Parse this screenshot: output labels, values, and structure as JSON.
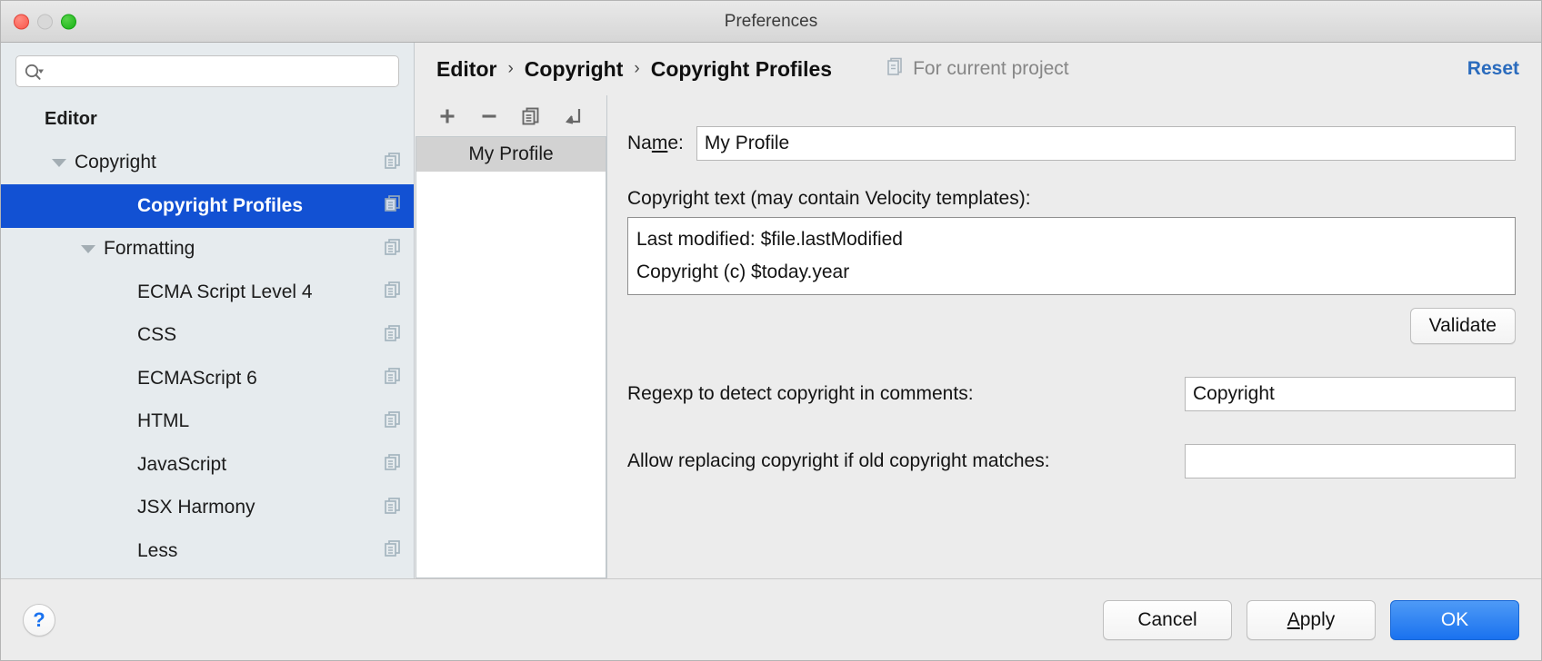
{
  "window": {
    "title": "Preferences",
    "traffic_lights": [
      "close",
      "minimize",
      "zoom"
    ]
  },
  "sidebar": {
    "search": {
      "value": "",
      "placeholder": "",
      "icon": "search-icon"
    },
    "items": [
      {
        "label": "Editor",
        "level": 0,
        "expandable": false,
        "expanded": false,
        "selected": false,
        "copy_badge": false
      },
      {
        "label": "Copyright",
        "level": 1,
        "expandable": true,
        "expanded": true,
        "selected": false,
        "copy_badge": true
      },
      {
        "label": "Copyright Profiles",
        "level": 3,
        "expandable": false,
        "expanded": false,
        "selected": true,
        "copy_badge": true
      },
      {
        "label": "Formatting",
        "level": 2,
        "expandable": true,
        "expanded": true,
        "selected": false,
        "copy_badge": true
      },
      {
        "label": "ECMA Script Level 4",
        "level": 3,
        "expandable": false,
        "expanded": false,
        "selected": false,
        "copy_badge": true
      },
      {
        "label": "CSS",
        "level": 3,
        "expandable": false,
        "expanded": false,
        "selected": false,
        "copy_badge": true
      },
      {
        "label": "ECMAScript 6",
        "level": 3,
        "expandable": false,
        "expanded": false,
        "selected": false,
        "copy_badge": true
      },
      {
        "label": "HTML",
        "level": 3,
        "expandable": false,
        "expanded": false,
        "selected": false,
        "copy_badge": true
      },
      {
        "label": "JavaScript",
        "level": 3,
        "expandable": false,
        "expanded": false,
        "selected": false,
        "copy_badge": true
      },
      {
        "label": "JSX Harmony",
        "level": 3,
        "expandable": false,
        "expanded": false,
        "selected": false,
        "copy_badge": true
      },
      {
        "label": "Less",
        "level": 3,
        "expandable": false,
        "expanded": false,
        "selected": false,
        "copy_badge": true
      }
    ],
    "selection_color": "#1251d3",
    "background_color": "#e6ebee"
  },
  "header": {
    "breadcrumb": [
      "Editor",
      "Copyright",
      "Copyright Profiles"
    ],
    "separator": "›",
    "scope_label": "For current project",
    "scope_icon": "project-scope-icon",
    "reset_label": "Reset",
    "reset_color": "#2a6bbd"
  },
  "profiles": {
    "toolbar": [
      {
        "name": "add-profile-button",
        "icon": "plus-icon"
      },
      {
        "name": "remove-profile-button",
        "icon": "minus-icon"
      },
      {
        "name": "copy-profile-button",
        "icon": "copy-icon"
      },
      {
        "name": "import-profile-button",
        "icon": "arrow-down-left-icon"
      }
    ],
    "items": [
      {
        "label": "My Profile",
        "selected": true
      }
    ]
  },
  "form": {
    "name_label_pre": "Na",
    "name_label_mnemonic": "m",
    "name_label_post": "e:",
    "name_value": "My Profile",
    "name_placeholder": "",
    "copyright_text_label": "Copyright text (may contain Velocity templates):",
    "copyright_text_value": "Last modified: $file.lastModified\nCopyright (c) $today.year",
    "validate_label": "Validate",
    "regexp_label": "Regexp to detect copyright in comments:",
    "regexp_value": "Copyright",
    "regexp_placeholder": "",
    "allow_replace_label": "Allow replacing copyright if old copyright matches:",
    "allow_replace_value": "",
    "allow_replace_placeholder": ""
  },
  "footer": {
    "help_label": "?",
    "cancel_label": "Cancel",
    "apply_label_pre": "",
    "apply_label_mnemonic": "A",
    "apply_label_post": "pply",
    "ok_label": "OK",
    "ok_color": "#1a72ef"
  }
}
